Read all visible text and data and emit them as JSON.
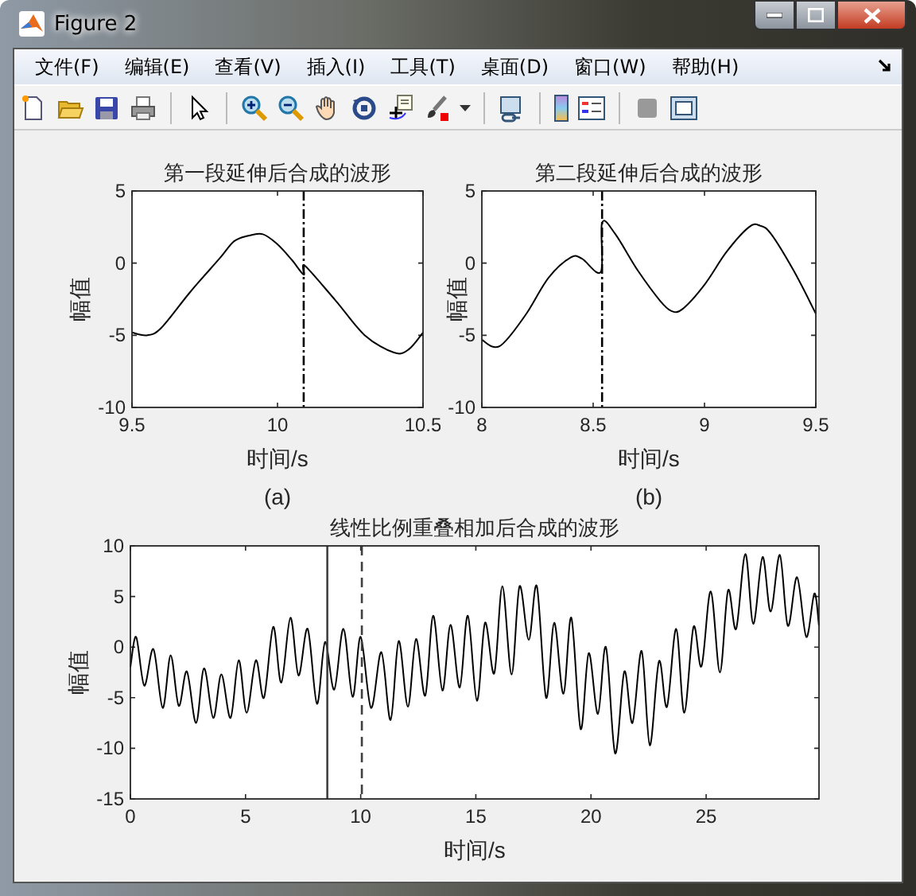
{
  "window": {
    "title": "Figure 2"
  },
  "menu": [
    "文件(F)",
    "编辑(E)",
    "查看(V)",
    "插入(I)",
    "工具(T)",
    "桌面(D)",
    "窗口(W)",
    "帮助(H)"
  ],
  "plots": [
    {
      "caption": "(a)",
      "chart_data": {
        "type": "line",
        "title": "第一段延伸后合成的波形",
        "xlabel": "时间/s",
        "ylabel": "幅值",
        "xlim": [
          9.5,
          10.5
        ],
        "ylim": [
          -10,
          5
        ],
        "xticks": [
          {
            "value": 9.5,
            "label": "9.5"
          },
          {
            "value": 10,
            "label": "10"
          },
          {
            "value": 10.5,
            "label": "10.5"
          }
        ],
        "yticks": [
          {
            "value": 5,
            "label": "5"
          },
          {
            "value": 0,
            "label": "0"
          },
          {
            "value": -5,
            "label": "-5"
          },
          {
            "value": -10,
            "label": "-10"
          }
        ],
        "x": [
          9.5,
          9.55,
          9.6,
          9.7,
          9.8,
          9.85,
          9.9,
          9.95,
          10.0,
          10.05,
          10.09,
          10.095,
          10.2,
          10.3,
          10.4,
          10.45,
          10.5
        ],
        "series": [
          {
            "color": "#000000",
            "values": [
              -4.8,
              -5.0,
              -4.5,
              -2.0,
              0.3,
              1.5,
              1.9,
              2.0,
              1.3,
              0.2,
              -0.8,
              -0.2,
              -2.6,
              -5.0,
              -6.2,
              -6.0,
              -4.8
            ]
          }
        ],
        "ref_lines": [
          {
            "axis": "x",
            "value": 10.09
          }
        ]
      }
    },
    {
      "caption": "(b)",
      "chart_data": {
        "type": "line",
        "title": "第二段延伸后合成的波形",
        "xlabel": "时间/s",
        "ylabel": "幅值",
        "xlim": [
          8,
          9.5
        ],
        "ylim": [
          -10,
          5
        ],
        "xticks": [
          {
            "value": 8,
            "label": "8"
          },
          {
            "value": 8.5,
            "label": "8.5"
          },
          {
            "value": 9,
            "label": "9"
          },
          {
            "value": 9.5,
            "label": "9.5"
          }
        ],
        "yticks": [
          {
            "value": 5,
            "label": "5"
          },
          {
            "value": 0,
            "label": "0"
          },
          {
            "value": -5,
            "label": "-5"
          },
          {
            "value": -10,
            "label": "-10"
          }
        ],
        "x": [
          8,
          8.05,
          8.1,
          8.2,
          8.3,
          8.4,
          8.45,
          8.535,
          8.54,
          8.6,
          8.7,
          8.8,
          8.85,
          8.9,
          9.0,
          9.1,
          9.2,
          9.25,
          9.3,
          9.4,
          9.5
        ],
        "series": [
          {
            "color": "#000000",
            "values": [
              -5.3,
              -5.8,
              -5.5,
              -3.5,
              -1.0,
              0.4,
              0.3,
              -0.6,
              2.8,
              2.0,
              -0.5,
              -2.6,
              -3.3,
              -3.2,
              -1.5,
              0.8,
              2.5,
              2.6,
              2.0,
              -0.5,
              -3.5
            ]
          }
        ],
        "ref_lines": [
          {
            "axis": "x",
            "value": 8.54
          }
        ]
      }
    },
    {
      "chart_data": {
        "type": "line",
        "title": "线性比例重叠相加后合成的波形",
        "xlabel": "时间/s",
        "ylabel": "幅值",
        "xlim": [
          0,
          29.9
        ],
        "ylim": [
          -15,
          10
        ],
        "xticks": [
          {
            "value": 0,
            "label": "0"
          },
          {
            "value": 5,
            "label": "5"
          },
          {
            "value": 10,
            "label": "10"
          },
          {
            "value": 15,
            "label": "15"
          },
          {
            "value": 20,
            "label": "20"
          },
          {
            "value": 25,
            "label": "25"
          }
        ],
        "yticks": [
          {
            "value": 10,
            "label": "10"
          },
          {
            "value": 5,
            "label": "5"
          },
          {
            "value": 0,
            "label": "0"
          },
          {
            "value": -5,
            "label": "-5"
          },
          {
            "value": -10,
            "label": "-10"
          },
          {
            "value": -15,
            "label": "-15"
          }
        ],
        "x": [
          0,
          0.25,
          0.6,
          1.0,
          1.4,
          1.75,
          2.1,
          2.45,
          2.85,
          3.2,
          3.6,
          3.95,
          4.35,
          4.7,
          5.05,
          5.45,
          5.8,
          6.2,
          6.55,
          6.95,
          7.3,
          7.7,
          8.1,
          8.45,
          8.85,
          9.25,
          9.65,
          10.0,
          10.45,
          10.9,
          11.3,
          11.65,
          12.05,
          12.4,
          12.8,
          13.15,
          13.55,
          13.9,
          14.3,
          14.65,
          15.05,
          15.4,
          15.8,
          16.15,
          16.55,
          16.9,
          17.3,
          17.65,
          18.05,
          18.4,
          18.8,
          19.15,
          19.55,
          19.9,
          20.3,
          20.65,
          21.05,
          21.45,
          21.8,
          22.2,
          22.55,
          22.95,
          23.3,
          23.7,
          24.05,
          24.45,
          24.8,
          25.2,
          25.6,
          25.95,
          26.3,
          26.7,
          27.05,
          27.45,
          27.8,
          28.2,
          28.55,
          28.95,
          29.35,
          29.7,
          29.9
        ],
        "series": [
          {
            "color": "#000000",
            "values": [
              -2,
              1,
              -3.8,
              -0.2,
              -6,
              -0.8,
              -5.8,
              -2.4,
              -7.5,
              -2.1,
              -7,
              -2.7,
              -7,
              -1.3,
              -6.5,
              -1.3,
              -5,
              2,
              -3.5,
              2.9,
              -2.8,
              1.8,
              -5.6,
              0.5,
              -4.2,
              1.8,
              -4.9,
              1.0,
              -6,
              -0.5,
              -7.2,
              0.6,
              -5.9,
              0.8,
              -4.8,
              3.1,
              -4.3,
              2.2,
              -4,
              3.1,
              -5.3,
              2.4,
              -2.6,
              6,
              -2.7,
              6,
              0.7,
              6,
              -5,
              2.4,
              -4.6,
              2.9,
              -8.1,
              -0.6,
              -6.6,
              0,
              -10.5,
              -2.4,
              -7.5,
              -0.4,
              -9.7,
              -1.4,
              -5.9,
              1.8,
              -6.5,
              2,
              -1.9,
              5.5,
              -2.5,
              5.6,
              1.8,
              9.2,
              2.3,
              8.9,
              3.5,
              9.1,
              2.1,
              6.9,
              1,
              5.3,
              2.1
            ]
          }
        ],
        "ref_lines": [
          {
            "axis": "x",
            "value": 8.55
          },
          {
            "axis": "x",
            "value": 10.05
          }
        ]
      }
    }
  ]
}
